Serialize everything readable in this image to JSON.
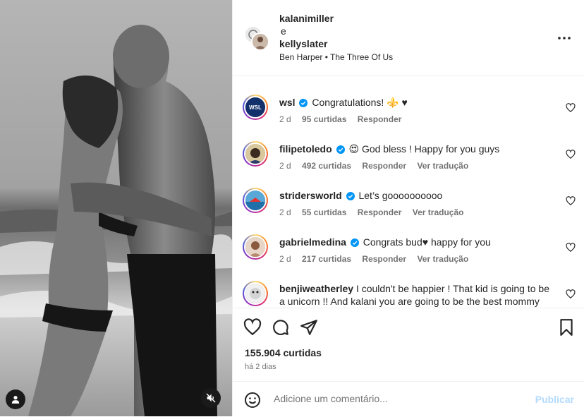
{
  "post": {
    "author_primary": "kalanimiller",
    "author_conjunction": "e",
    "author_secondary": "kellyslater",
    "music": "Ben Harper • The Three Of Us"
  },
  "comments": [
    {
      "user": "wsl",
      "text": "Congratulations! ⚜️ ♥",
      "time": "2 d",
      "likes": "95 curtidas",
      "reply": "Responder",
      "translate": ""
    },
    {
      "user": "filipetoledo",
      "text": "😍 God bless ! Happy for you guys",
      "time": "2 d",
      "likes": "492 curtidas",
      "reply": "Responder",
      "translate": "Ver tradução"
    },
    {
      "user": "stridersworld",
      "text": "Let’s goooooooooo",
      "time": "2 d",
      "likes": "55 curtidas",
      "reply": "Responder",
      "translate": "Ver tradução"
    },
    {
      "user": "gabrielmedina",
      "text": "Congrats bud♥ happy for you",
      "time": "2 d",
      "likes": "217 curtidas",
      "reply": "Responder",
      "translate": "Ver tradução"
    },
    {
      "user": "benjiweatherley",
      "text": "I couldn't be happier ! That kid is going to be a unicorn !! And kalani you are going to be the best mommy",
      "time": "",
      "likes": "",
      "reply": "",
      "translate": ""
    }
  ],
  "actions": {
    "likes": "155.904 curtidas",
    "posted": "há 2 dias"
  },
  "composer": {
    "placeholder": "Adicione um comentário...",
    "publish": "Publicar"
  },
  "icons": {
    "like": "heart-icon",
    "comment": "comment-icon",
    "share": "share-icon",
    "save": "bookmark-icon",
    "more": "more-options-icon",
    "emoji": "emoji-icon",
    "tag": "user-tag-icon",
    "mute": "mute-icon"
  },
  "colors": {
    "verified": "#0095f6",
    "publish_disabled": "#b3dbff",
    "muted_text": "#737373"
  }
}
